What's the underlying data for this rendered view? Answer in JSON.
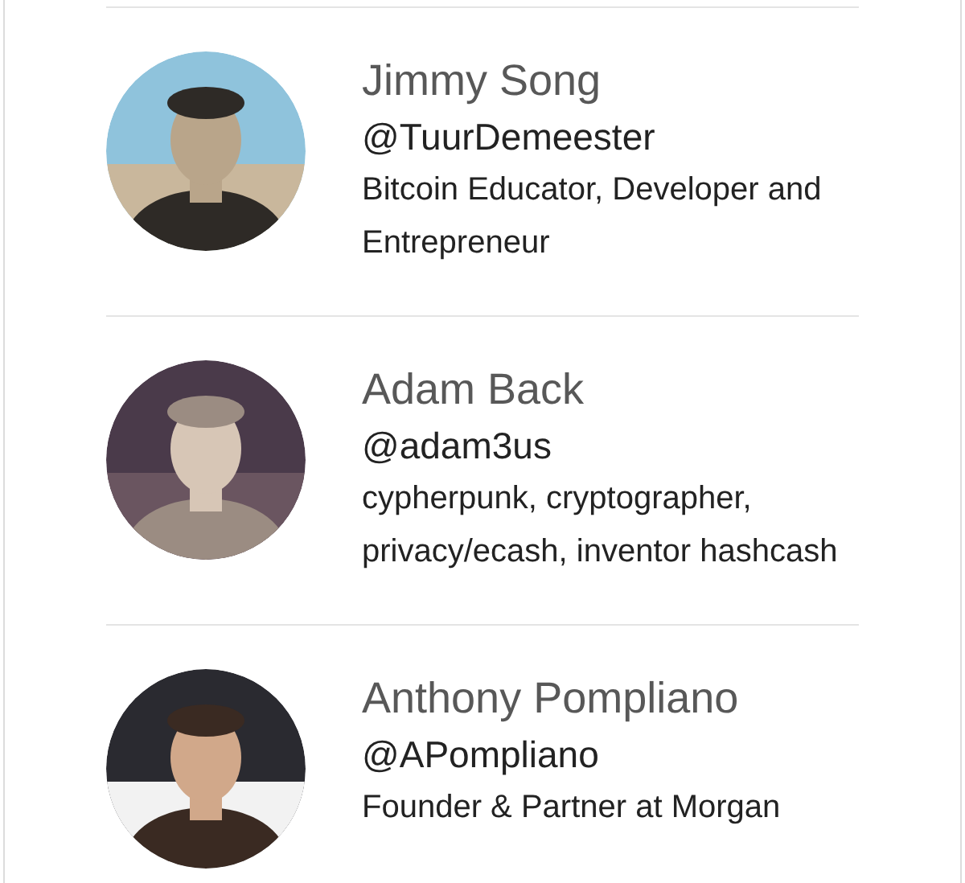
{
  "people": [
    {
      "name": "Jimmy Song",
      "handle": "@TuurDemeester",
      "bio": "Bitcoin Educator, Developer and Entrepreneur"
    },
    {
      "name": "Adam Back",
      "handle": "@adam3us",
      "bio": "cypherpunk, cryptographer, privacy/ecash, inventor hashcash"
    },
    {
      "name": "Anthony Pompliano",
      "handle": "@APompliano",
      "bio": "Founder & Partner at Morgan"
    }
  ]
}
